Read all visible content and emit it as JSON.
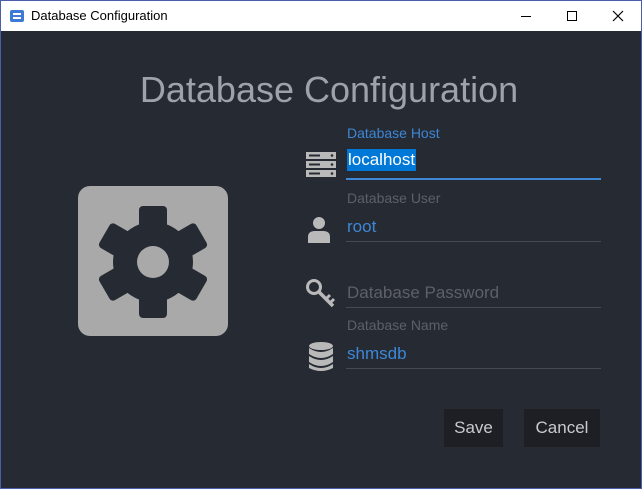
{
  "window": {
    "title": "Database Configuration",
    "controls": [
      "minimize",
      "maximize",
      "close"
    ]
  },
  "main": {
    "heading": "Database Configuration",
    "fields": [
      {
        "icon": "server-icon",
        "label": "Database Host",
        "value": "localhost",
        "focused": true,
        "selected": true
      },
      {
        "icon": "user-icon",
        "label": "Database User",
        "value": "root"
      },
      {
        "icon": "key-icon",
        "label": "",
        "value": "",
        "placeholder": "Database Password"
      },
      {
        "icon": "database-icon",
        "label": "Database Name",
        "value": "shmsdb"
      }
    ],
    "buttons": {
      "save": "Save",
      "cancel": "Cancel"
    }
  },
  "colors": {
    "background": "#262a33",
    "accent": "#3d87d6",
    "label": "#5d6068",
    "icon": "#b9b9b9",
    "button_bg": "#1d1f24"
  }
}
